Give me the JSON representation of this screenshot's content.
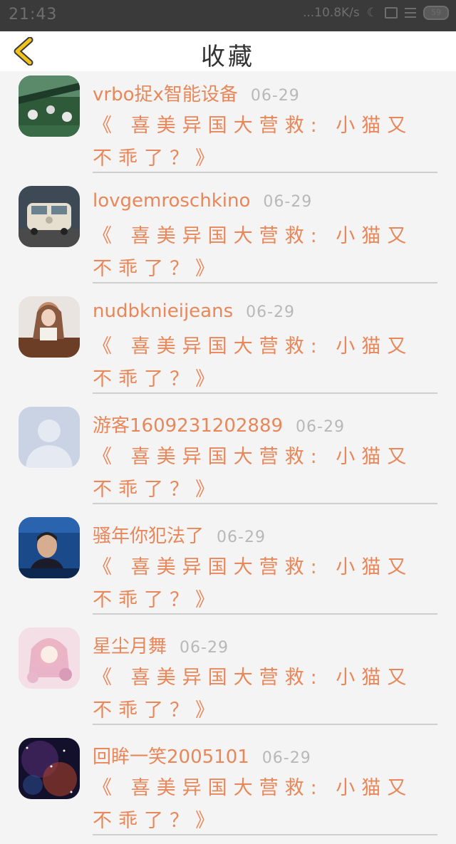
{
  "status_bar": {
    "time": "21:43",
    "net_speed": "10.8K/s",
    "battery": "59"
  },
  "header": {
    "title": "收藏"
  },
  "items": [
    {
      "name": "vrbo捉x智能设备",
      "date": "06-29",
      "title": "《 喜美异国大营救: 小猫又不乖了？》",
      "avatar": "avatar-decor"
    },
    {
      "name": "lovgemroschkino",
      "date": "06-29",
      "title": "《 喜美异国大营救: 小猫又不乖了？》",
      "avatar": "avatar-van"
    },
    {
      "name": "nudbknieijeans",
      "date": "06-29",
      "title": "《 喜美异国大营救: 小猫又不乖了？》",
      "avatar": "avatar-girl"
    },
    {
      "name": "游客1609231202889",
      "date": "06-29",
      "title": "《 喜美异国大营救: 小猫又不乖了？》",
      "avatar": "avatar-default"
    },
    {
      "name": "骚年你犯法了",
      "date": "06-29",
      "title": "《 喜美异国大营救: 小猫又不乖了？》",
      "avatar": "avatar-man"
    },
    {
      "name": "星尘月舞",
      "date": "06-29",
      "title": "《 喜美异国大营救: 小猫又不乖了？》",
      "avatar": "avatar-anime"
    },
    {
      "name": "回眸一笑2005101",
      "date": "06-29",
      "title": "《 喜美异国大营救: 小猫又不乖了？》",
      "avatar": "avatar-galaxy"
    }
  ],
  "colors": {
    "accent": "#e8875a",
    "date": "#b8b8b8",
    "back_arrow": "#f3c21b"
  }
}
